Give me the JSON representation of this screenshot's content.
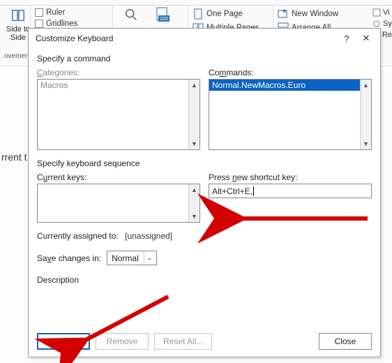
{
  "ribbon": {
    "side_label": "Side to Side",
    "ruler": "Ruler",
    "gridlines": "Gridlines",
    "group_movement": "ovement",
    "zoom": "Zoom",
    "hundred": "100",
    "one_page": "One Page",
    "multiple_pages": "Multiple Pages",
    "new_window": "New Window",
    "arrange_all": "Arrange All",
    "sliver_vi": "Vi",
    "sliver_sy": "Sy",
    "sliver_re": "Re"
  },
  "doc_frag": "rrent t",
  "dialog": {
    "title": "Customize Keyboard",
    "help": "?",
    "close_x": "✕",
    "specify_command": "Specify a command",
    "categories_label": "Categories:",
    "categories_item": "Macros",
    "commands_label": "Commands:",
    "commands_item": "Normal.NewMacros.Euro",
    "specify_sequence": "Specify keyboard sequence",
    "current_keys_label": "Current keys:",
    "press_new_label": "Press new shortcut key:",
    "shortcut_value": "Alt+Ctrl+E,",
    "assigned_label": "Currently assigned to:",
    "assigned_value": "[unassigned]",
    "save_label": "Save changes in:",
    "save_value": "Normal",
    "description_label": "Description",
    "assign_btn": "Assign",
    "remove_btn": "Remove",
    "reset_btn": "Reset All...",
    "close_btn": "Close"
  }
}
